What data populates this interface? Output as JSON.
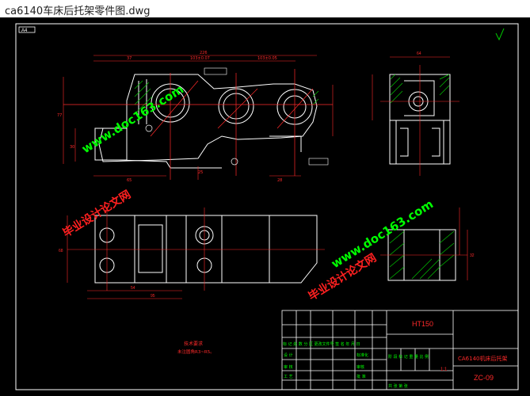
{
  "window": {
    "title": "ca6140车床后托架零件图.dwg"
  },
  "colors": {
    "frame": "#ffffff",
    "part": "#ffffff",
    "dim": "#ff2a2a",
    "center": "#ff2a2a",
    "hatch": "#00c800",
    "wm_green": "#00ff00",
    "wm_red": "#ff2020"
  },
  "corner_label": "A4",
  "watermarks": {
    "site": "www.doc163.com",
    "name": "毕业设计论文网"
  },
  "title_block": {
    "material": "HT150",
    "part_name": "CA6140机床后托架",
    "drawing_no": "ZC-09",
    "scale": "1:1",
    "header_row": "标 记 处 数  分 区  更改文件号  签 名  年 月 日",
    "rows": [
      {
        "col1": "设 计",
        "col2": "",
        "col3": "标准化",
        "col4": ""
      },
      {
        "col1": "审 核",
        "col2": "",
        "col3": "审核",
        "col4": ""
      },
      {
        "col1": "工 艺",
        "col2": "",
        "col3": "批 准",
        "col4": ""
      }
    ],
    "stage_header": "阶 段 标 记   重 量   比 例",
    "sheet_info": "共   张   第   张"
  },
  "tech_requirements": {
    "heading": "技术要求",
    "text": "未注圆角R3~R5。"
  },
  "dimensions": {
    "top_overall": "226",
    "d1": "37",
    "d2": "103±0.07",
    "d3": "103±0.05",
    "side_width": "64",
    "height_left": "77",
    "height_small": "30",
    "mid": "25",
    "bottom_a": "65",
    "bottom_b": "28",
    "plan_a": "54",
    "plan_b": "95",
    "plan_h": "68",
    "side_h": "32"
  }
}
